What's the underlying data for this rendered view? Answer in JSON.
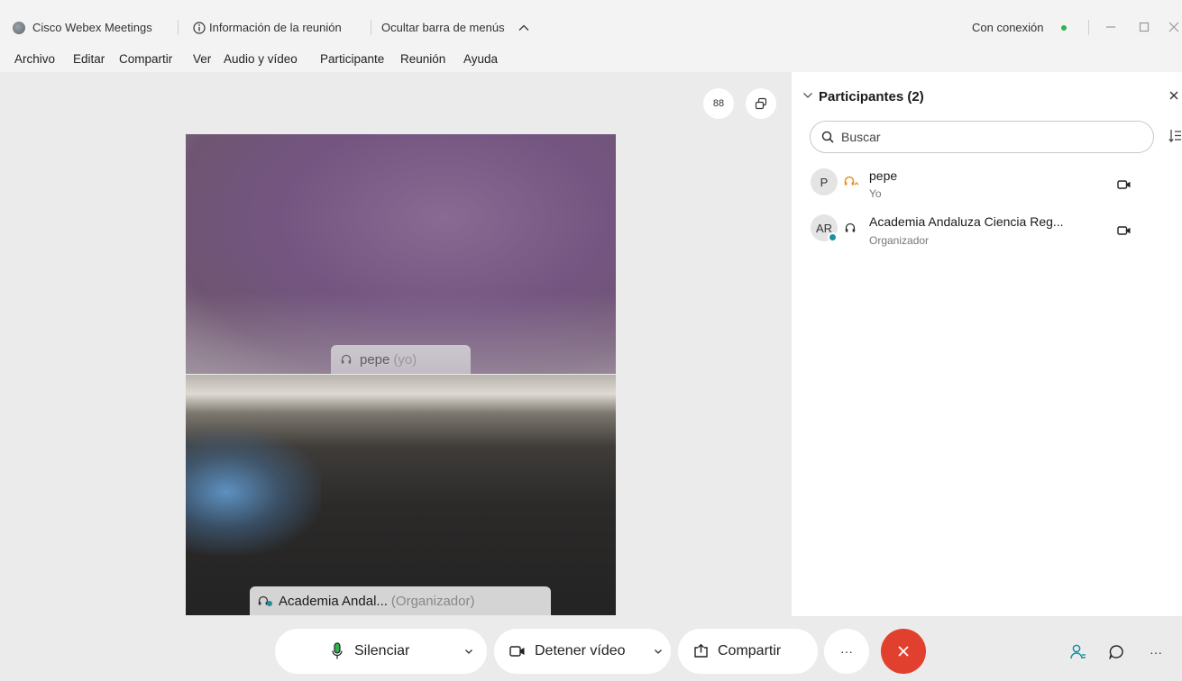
{
  "titlebar": {
    "app_name": "Cisco Webex Meetings",
    "meeting_info": "Información de la reunión",
    "hide_menu": "Ocultar barra de menús",
    "connection_status": "Con conexión"
  },
  "menu": {
    "items": [
      "Archivo",
      "Editar",
      "Compartir",
      "Ver",
      "Audio y vídeo",
      "Participante",
      "Reunión",
      "Ayuda"
    ]
  },
  "stage": {
    "grid_view_label": "88",
    "self_tile": {
      "name": "pepe",
      "suffix": "(yo)"
    },
    "organizer_tile": {
      "name": "Academia Andal...",
      "suffix": "(Organizador)"
    }
  },
  "participants": {
    "title": "Participantes (2)",
    "search_placeholder": "Buscar",
    "list": [
      {
        "initials": "P",
        "name": "pepe",
        "role": "Yo"
      },
      {
        "initials": "AR",
        "name": "Academia Andaluza Ciencia Reg...",
        "role": "Organizador"
      }
    ]
  },
  "controls": {
    "mute_label": "Silenciar",
    "stop_video_label": "Detener vídeo",
    "share_label": "Compartir",
    "more_label": "···"
  },
  "colors": {
    "leave_red": "#e2402f",
    "connected_green": "#2fb34d",
    "audio_orange": "#e8912a",
    "accent_teal": "#1e8fa3"
  }
}
